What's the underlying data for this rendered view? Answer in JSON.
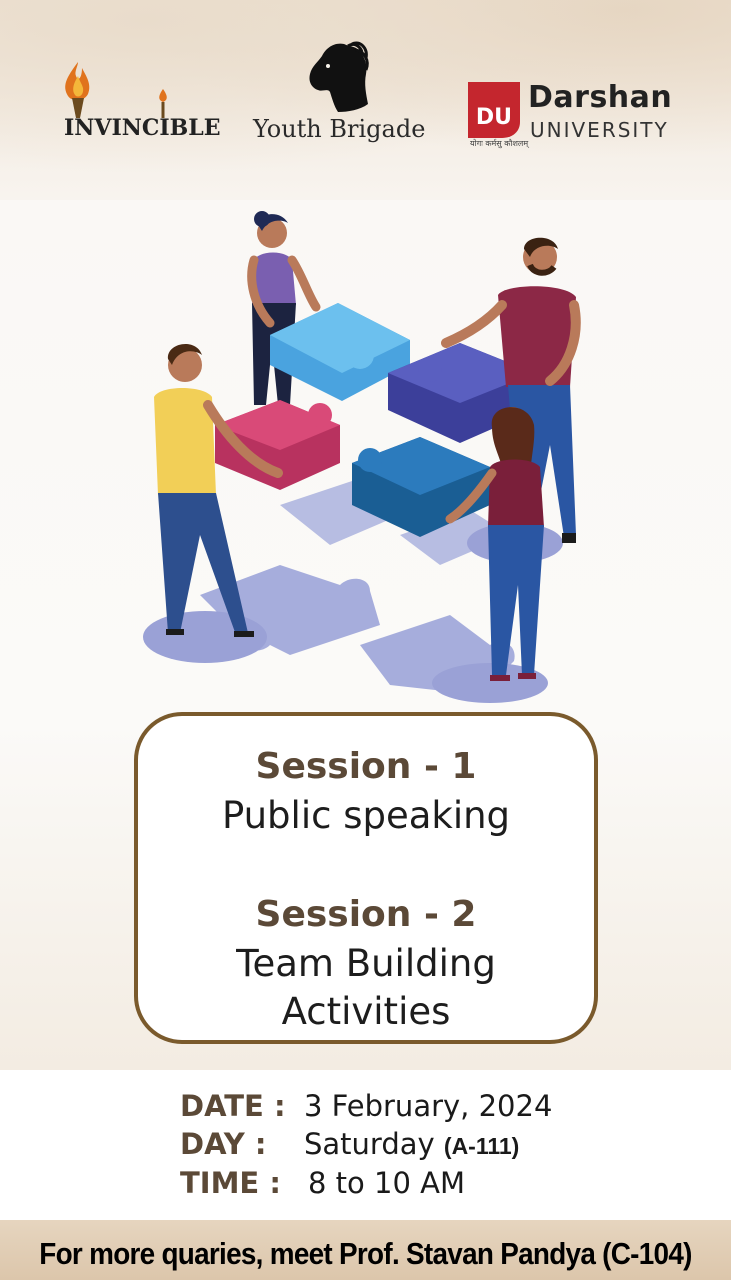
{
  "logos": {
    "left": {
      "text": "INVINCIBLE"
    },
    "center": {
      "text": "Youth Brigade"
    },
    "right": {
      "name": "Darshan",
      "subtitle": "UNIVERSITY",
      "motto": "योगः कर्मसु कौशलम्",
      "mark": "DU"
    }
  },
  "sessions": [
    {
      "title": "Session - 1",
      "lines": [
        "Public speaking"
      ]
    },
    {
      "title": "Session - 2",
      "lines": [
        "Team Building",
        "Activities"
      ]
    }
  ],
  "details": {
    "date_label": "DATE :",
    "date_value": "3 February, 2024",
    "day_label": "DAY :",
    "day_value": "Saturday",
    "room": "(A-111)",
    "time_label": "TIME :",
    "time_value": "8 to 10 AM"
  },
  "footer": "For more quaries, meet Prof. Stavan Pandya (C-104)",
  "colors": {
    "frame": "#7a5a2c",
    "heading": "#5b4937",
    "du_red": "#c4262e"
  }
}
